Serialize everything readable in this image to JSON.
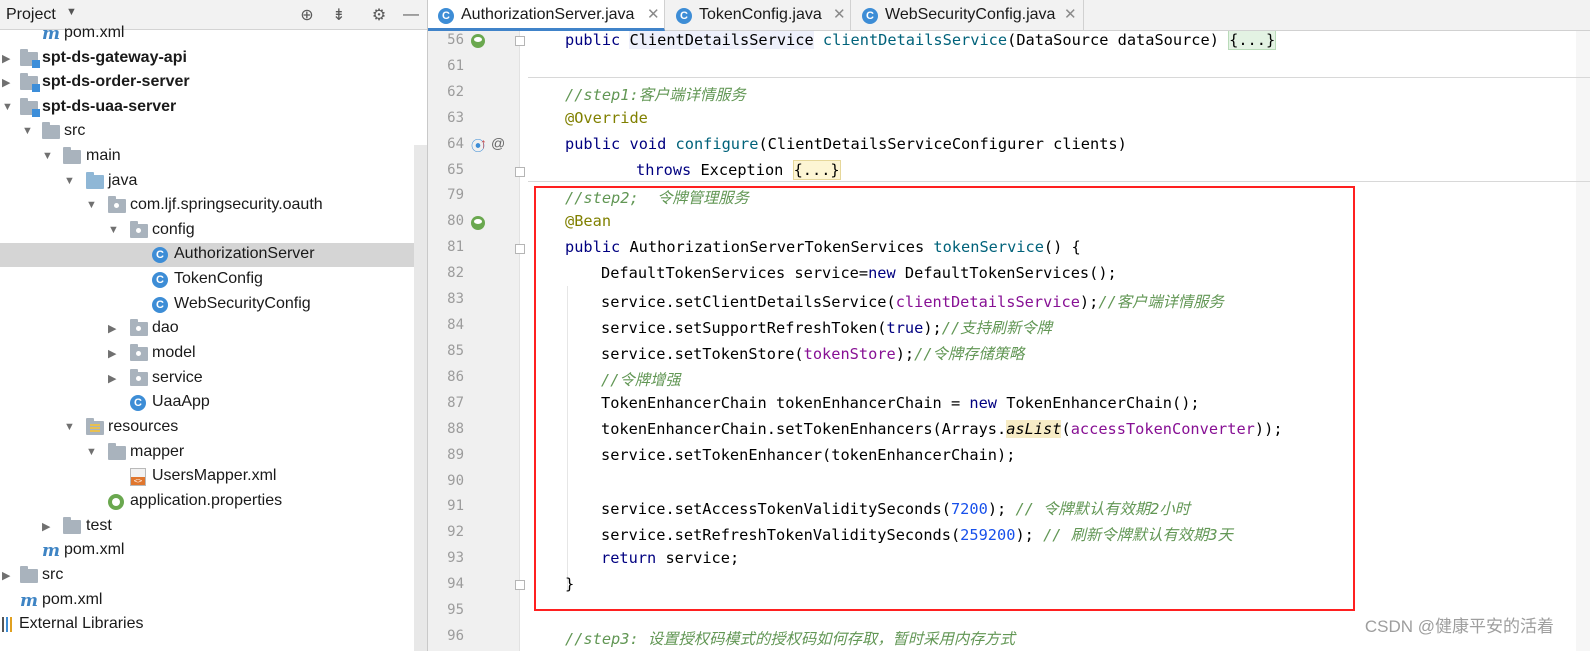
{
  "project_panel": {
    "title": "Project",
    "tree": [
      {
        "label": "pom.xml",
        "icon": "maven-icon"
      },
      {
        "label": "spt-ds-gateway-api",
        "icon": "module-folder-icon"
      },
      {
        "label": "spt-ds-order-server",
        "icon": "module-folder-icon"
      },
      {
        "label": "spt-ds-uaa-server",
        "icon": "module-folder-icon"
      },
      {
        "label": "src",
        "icon": "folder-icon"
      },
      {
        "label": "main",
        "icon": "folder-icon"
      },
      {
        "label": "java",
        "icon": "source-folder-icon"
      },
      {
        "label": "com.ljf.springsecurity.oauth",
        "icon": "package-icon"
      },
      {
        "label": "config",
        "icon": "package-icon"
      },
      {
        "label": "AuthorizationServer",
        "icon": "class-icon"
      },
      {
        "label": "TokenConfig",
        "icon": "class-icon"
      },
      {
        "label": "WebSecurityConfig",
        "icon": "class-icon"
      },
      {
        "label": "dao",
        "icon": "package-icon"
      },
      {
        "label": "model",
        "icon": "package-icon"
      },
      {
        "label": "service",
        "icon": "package-icon"
      },
      {
        "label": "UaaApp",
        "icon": "spring-boot-class-icon"
      },
      {
        "label": "resources",
        "icon": "resources-folder-icon"
      },
      {
        "label": "mapper",
        "icon": "folder-icon"
      },
      {
        "label": "UsersMapper.xml",
        "icon": "xml-file-icon"
      },
      {
        "label": "application.properties",
        "icon": "properties-file-icon"
      },
      {
        "label": "test",
        "icon": "folder-icon"
      },
      {
        "label": "pom.xml",
        "icon": "maven-icon"
      },
      {
        "label": "src",
        "icon": "folder-icon"
      },
      {
        "label": "pom.xml",
        "icon": "maven-icon"
      },
      {
        "label": "External Libraries",
        "icon": "libraries-icon"
      }
    ]
  },
  "tabs": [
    {
      "label": "AuthorizationServer.java",
      "active": true
    },
    {
      "label": "TokenConfig.java",
      "active": false
    },
    {
      "label": "WebSecurityConfig.java",
      "active": false
    }
  ],
  "class_icon_letter": "C",
  "editor": {
    "line_numbers": [
      "56",
      "61",
      "62",
      "63",
      "64",
      "65",
      "79",
      "80",
      "81",
      "82",
      "83",
      "84",
      "85",
      "86",
      "87",
      "88",
      "89",
      "90",
      "91",
      "92",
      "93",
      "94",
      "95",
      "96"
    ],
    "fold_placeholder": "{...}",
    "words": {
      "public": "public",
      "void": "void",
      "throws": "throws",
      "new": "new",
      "true": "true",
      "return": "return",
      "override": "@Override",
      "bean": "@Bean"
    },
    "l56": {
      "type": "ClientDetailsService",
      "method": "clientDetailsService",
      "args": "(DataSource dataSource) "
    },
    "l62_comment": "//step1:客户端详情服务",
    "l64": {
      "method": "configure",
      "args": "(ClientDetailsServiceConfigurer clients)"
    },
    "l65": {
      "rest": " Exception "
    },
    "l79_comment": "//step2;  令牌管理服务",
    "l81": {
      "type": " AuthorizationServerTokenServices ",
      "method": "tokenService",
      "rest": "() {"
    },
    "l82": {
      "a": "DefaultTokenServices service=",
      "b": " DefaultTokenServices();"
    },
    "l83": {
      "a": "service.setClientDetailsService(",
      "field": "clientDetailsService",
      "b": ");",
      "comment": "//客户端详情服务"
    },
    "l84": {
      "a": "service.setSupportRefreshToken(",
      "b": ");",
      "comment": "//支持刷新令牌"
    },
    "l85": {
      "a": "service.setTokenStore(",
      "field": "tokenStore",
      "b": ");",
      "comment": "//令牌存储策略"
    },
    "l86_comment": "//令牌增强",
    "l87": {
      "a": "TokenEnhancerChain tokenEnhancerChain = ",
      "b": " TokenEnhancerChain();"
    },
    "l88": {
      "a": "tokenEnhancerChain.setTokenEnhancers(Arrays.",
      "call": "asList",
      "b": "(",
      "field": "accessTokenConverter",
      "c": "));"
    },
    "l89": "service.setTokenEnhancer(tokenEnhancerChain);",
    "l91": {
      "a": "service.setAccessTokenValiditySeconds(",
      "num": "7200",
      "b": "); ",
      "comment": "// 令牌默认有效期2小时"
    },
    "l92": {
      "a": "service.setRefreshTokenValiditySeconds(",
      "num": "259200",
      "b": "); ",
      "comment": "// 刷新令牌默认有效期3天"
    },
    "l93": " service;",
    "l94": "}",
    "l96_comment": "//step3: 设置授权码模式的授权码如何存取，暂时采用内存方式"
  },
  "watermark": "CSDN @健康平安的活着",
  "colors": {
    "highlight_box": "#ff2020",
    "selection": "#d5d5d5",
    "tab_underline": "#4083c9"
  }
}
